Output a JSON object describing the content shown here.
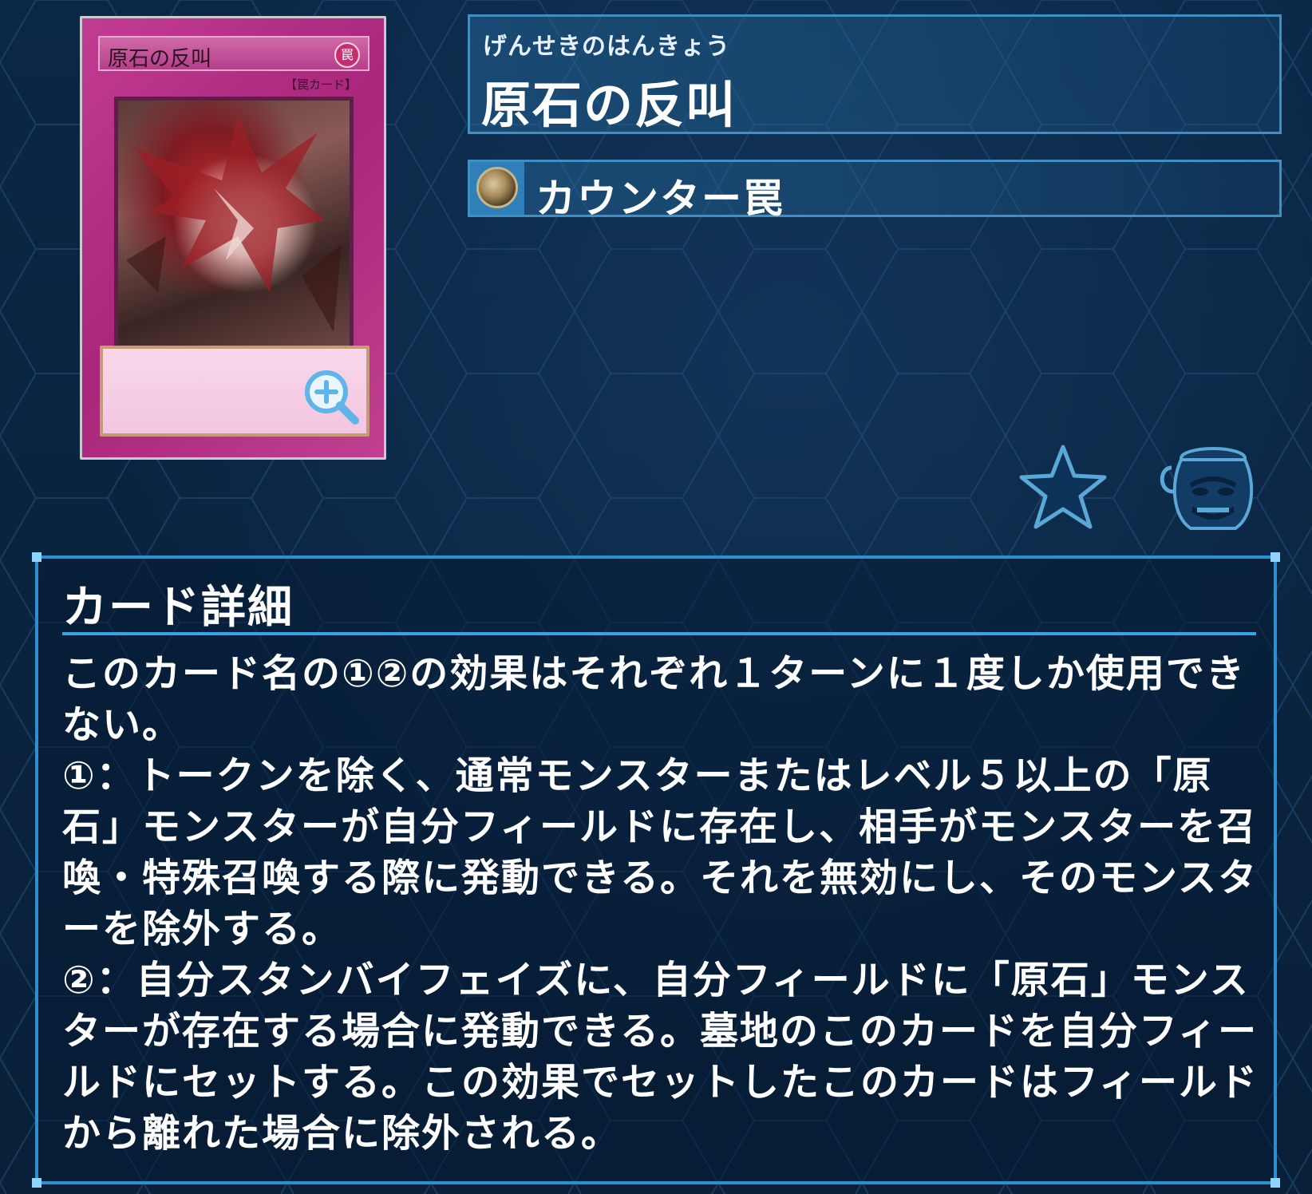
{
  "card": {
    "printed_name": "原石の反叫",
    "printed_type": "【罠カード】",
    "attribute_glyph": "罠",
    "zoom_icon": "zoom-in-icon"
  },
  "header": {
    "ruby": "げんせきのはんきょう",
    "title": "原石の反叫"
  },
  "type": {
    "icon": "counter-trap-icon",
    "label": "カウンター罠"
  },
  "actions": {
    "favorite_icon": "star-icon",
    "pot_icon": "pot-of-greed-icon"
  },
  "detail": {
    "heading": "カード詳細",
    "text": "このカード名の①②の効果はそれぞれ１ターンに１度しか使用できない。\n①：トークンを除く、通常モンスターまたはレベル５以上の「原石」モンスターが自分フィールドに存在し、相手がモンスターを召喚・特殊召喚する際に発動できる。それを無効にし、そのモンスターを除外する。\n②：自分スタンバイフェイズに、自分フィールドに「原石」モンスターが存在する場合に発動できる。墓地のこのカードを自分フィールドにセットする。この効果でセットしたこのカードはフィールドから離れた場合に除外される。"
  },
  "colors": {
    "background": "#0a2340",
    "panel_border": "#3f8fc2",
    "trap_card": "#b5308a"
  }
}
